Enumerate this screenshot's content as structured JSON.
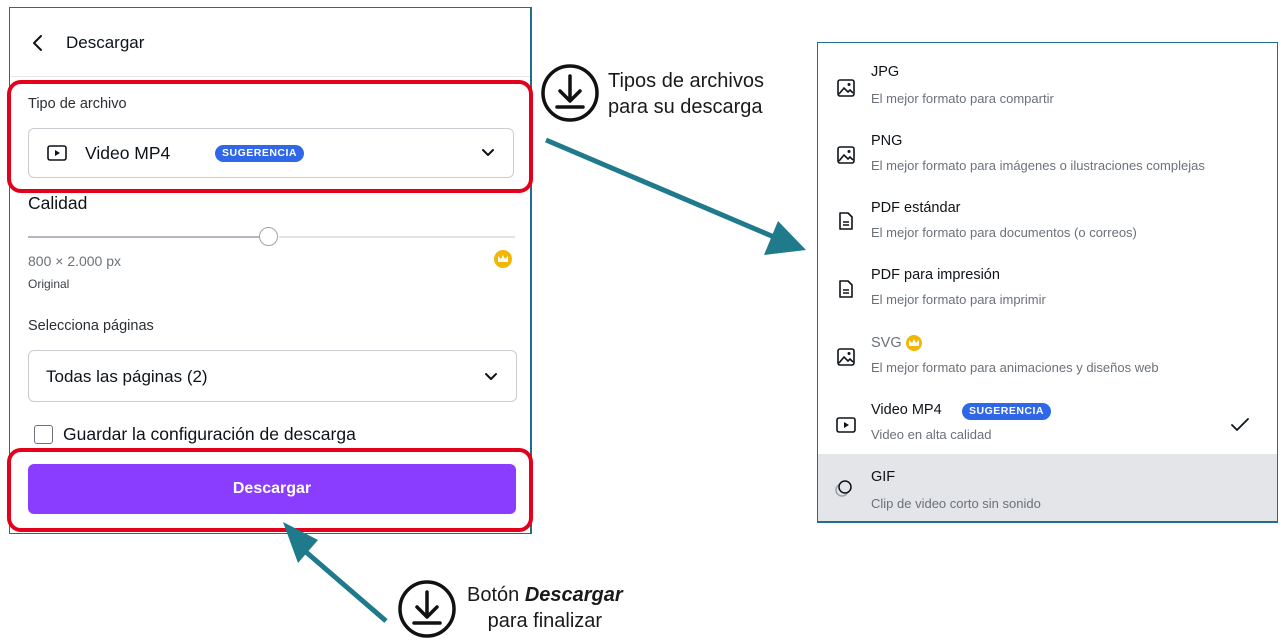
{
  "panel": {
    "title": "Descargar",
    "file_type_label": "Tipo de archivo",
    "file_type_value": "Video MP4",
    "file_type_badge": "SUGERENCIA",
    "quality_label": "Calidad",
    "quality_level_percent": 48,
    "dimensions": "800 × 2.000 px",
    "size_name": "Original",
    "pages_label": "Selecciona páginas",
    "pages_value": "Todas las páginas (2)",
    "save_settings_label": "Guardar la configuración de descarga",
    "save_settings_checked": false,
    "download_button": "Descargar"
  },
  "annotations": {
    "top_callout_line1": "Tipos de archivos",
    "top_callout_line2": "para su descarga",
    "bottom_callout_prefix": "Botón ",
    "bottom_callout_emphasis": "Descargar",
    "bottom_callout_line2": "para finalizar",
    "highlight_color": "#e3001b",
    "arrow_color": "#1f7a8c"
  },
  "file_types": [
    {
      "title": "JPG",
      "description": "El mejor formato para compartir",
      "icon": "image-icon"
    },
    {
      "title": "PNG",
      "description": "El mejor formato para imágenes o ilustraciones complejas",
      "icon": "image-icon"
    },
    {
      "title": "PDF estándar",
      "description": "El mejor formato para documentos (o correos)",
      "icon": "document-icon"
    },
    {
      "title": "PDF para impresión",
      "description": "El mejor formato para imprimir",
      "icon": "document-icon"
    },
    {
      "title": "SVG",
      "description": "El mejor formato para animaciones y diseños web",
      "icon": "image-icon",
      "premium": true
    },
    {
      "title": "Video MP4",
      "description": "Video en alta calidad",
      "icon": "video-icon",
      "badge": "SUGERENCIA",
      "selected": true
    },
    {
      "title": "GIF",
      "description": "Clip de video corto sin sonido",
      "icon": "gif-icon",
      "hovered": true
    }
  ],
  "colors": {
    "accent_purple": "#8b3dff",
    "badge_blue": "#2f67e8",
    "premium_gold": "#f2b705"
  }
}
